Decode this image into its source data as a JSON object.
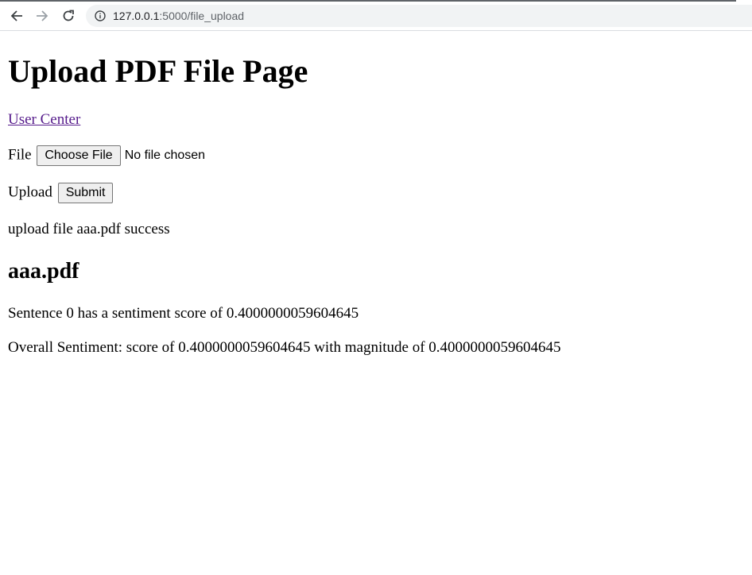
{
  "browser": {
    "url_host": "127.0.0.1",
    "url_path": ":5000/file_upload"
  },
  "page": {
    "title": "Upload PDF File Page",
    "user_center_link": "User Center",
    "file_label": "File",
    "choose_file_button": "Choose File",
    "no_file_text": "No file chosen",
    "upload_label": "Upload",
    "submit_button": "Submit",
    "status_message": "upload file aaa.pdf success",
    "filename_heading": "aaa.pdf",
    "sentence_result": "Sentence 0 has a sentiment score of 0.4000000059604645",
    "overall_result": "Overall Sentiment: score of 0.4000000059604645 with magnitude of 0.4000000059604645"
  }
}
